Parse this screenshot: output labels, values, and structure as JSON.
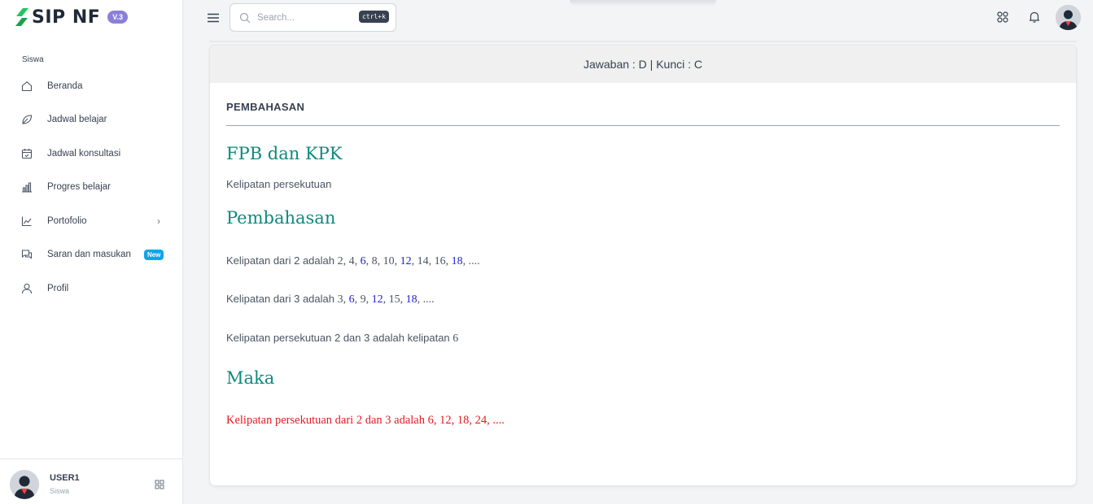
{
  "brand": {
    "name": "SIP NF",
    "version": "V.3"
  },
  "sidebar": {
    "section_label": "Siswa",
    "items": [
      {
        "label": "Beranda",
        "icon": "home-icon"
      },
      {
        "label": "Jadwal belajar",
        "icon": "leaf-icon"
      },
      {
        "label": "Jadwal konsultasi",
        "icon": "calendar-check-icon"
      },
      {
        "label": "Progres belajar",
        "icon": "bar-chart-icon"
      },
      {
        "label": "Portofolio",
        "icon": "line-chart-icon"
      },
      {
        "label": "Saran dan masukan",
        "icon": "chat-icon",
        "badge": "New"
      },
      {
        "label": "Profil",
        "icon": "user-icon"
      }
    ],
    "user": {
      "name": "USER1",
      "role": "Siswa"
    }
  },
  "topbar": {
    "search_placeholder": "Search...",
    "shortcut": "ctrl+k"
  },
  "card": {
    "header": "Jawaban : D | Kunci : C",
    "section_title": "PEMBAHASAN",
    "heading1": "FPB dan KPK",
    "subtitle": "Kelipatan persekutuan",
    "heading2": "Pembahasan",
    "line1_text": "Kelipatan dari 2 adalah",
    "line1_parts": [
      "2, 4, ",
      "6",
      ", 8, 10, ",
      "12",
      ", 14, 16, ",
      "18",
      ", ...."
    ],
    "line2_text": "Kelipatan dari 3 adalah",
    "line2_parts": [
      "3, ",
      "6",
      ", 9, ",
      "12",
      ", 15, ",
      "18",
      ", ...."
    ],
    "line3_text": "Kelipatan persekutuan 2 dan 3 adalah kelipatan",
    "line3_value": "6",
    "heading3": "Maka",
    "conclusion": "Kelipatan persekutuan dari 2 dan 3 adalah 6, 12, 18, 24, ...."
  },
  "colors": {
    "accent_teal": "#0d8a7e",
    "highlight_blue": "#1d1dd6",
    "conclusion_red": "#e11d1d",
    "badge_sky": "#0ea5e9",
    "version_purple": "#8b7fd8"
  }
}
